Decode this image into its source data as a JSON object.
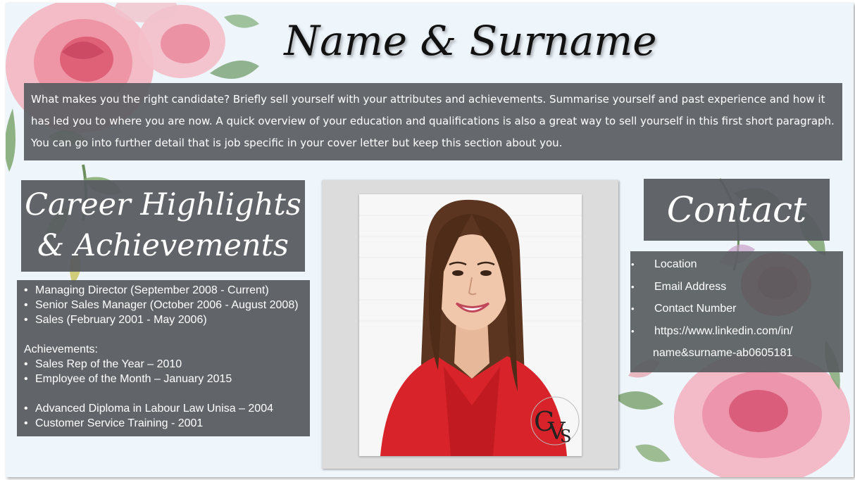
{
  "header": {
    "name": "Name & Surname",
    "summary": "What makes you the right candidate? Briefly sell yourself with your attributes and achievements. Summarise yourself and past experience and how it has led you to where you are now. A quick overview of your education and qualifications is also a great way to sell yourself in this first short paragraph. You can go into further detail that is job specific in your cover letter but keep this section about you."
  },
  "career": {
    "heading_line1": "Career Highlights",
    "heading_line2": "& Achievements",
    "positions": [
      "Managing Director (September 2008 - Current)",
      "Senior Sales Manager (October 2006 - August 2008)",
      "Sales (February 2001 - May 2006)"
    ],
    "achievements_label": "Achievements:",
    "achievements": [
      "Sales Rep of the Year – 2010",
      "Employee of the Month – January 2015"
    ],
    "education": [
      "Advanced Diploma in Labour Law Unisa – 2004",
      "Customer Service Training - 2001"
    ]
  },
  "contact": {
    "heading": "Contact",
    "location": "Location",
    "email": "Email Address",
    "number": "Contact Number",
    "linkedin_line1": "https://www.linkedin.com/in/",
    "linkedin_line2": "name&surname-ab0605181"
  },
  "colors": {
    "panel": "#5a5e62",
    "background": "#eef5fb",
    "blazer": "#d8232a"
  }
}
